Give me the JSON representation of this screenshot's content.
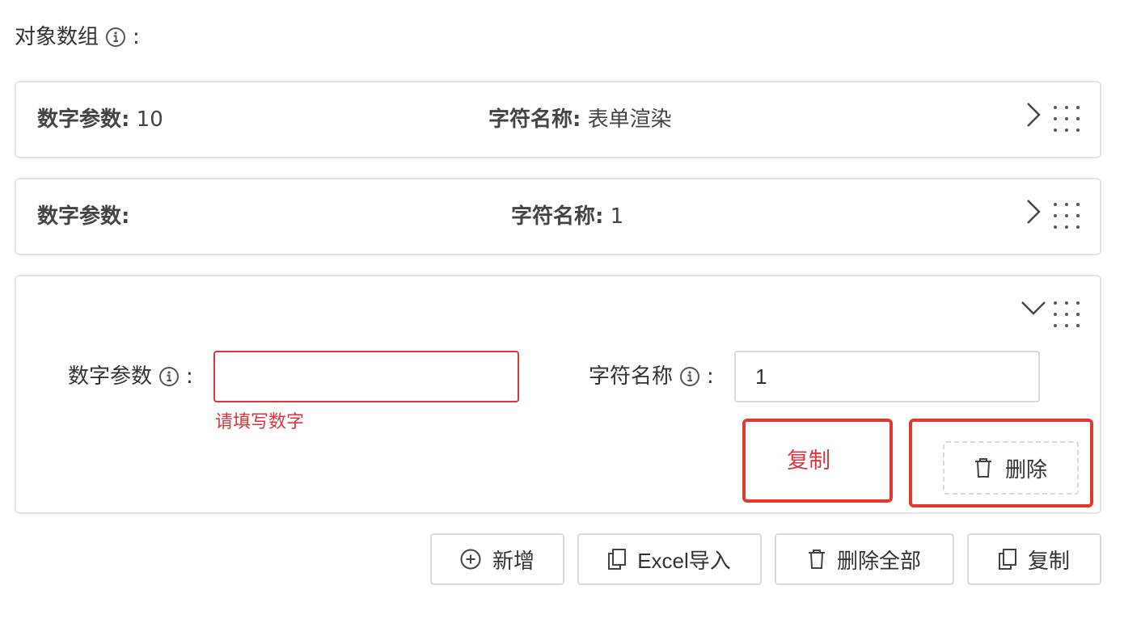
{
  "section": {
    "title": "对象数组",
    "colon": ":"
  },
  "items": [
    {
      "number_label": "数字参数:",
      "number_value": "10",
      "name_label": "字符名称:",
      "name_value": "表单渲染"
    },
    {
      "number_label": "数字参数:",
      "number_value": "",
      "name_label": "字符名称:",
      "name_value": "1"
    }
  ],
  "expanded": {
    "number_label": "数字参数",
    "number_value": "",
    "number_error": "请填写数字",
    "name_label": "字符名称",
    "name_value": "1",
    "colon": ":",
    "copy_label": "复制",
    "delete_label": "删除"
  },
  "toolbar": {
    "add_label": "新增",
    "excel_label": "Excel导入",
    "delete_all_label": "删除全部",
    "copy_label": "复制"
  },
  "colors": {
    "error": "#d9363e",
    "highlight": "#e03a2e",
    "border": "#d9d9d9"
  },
  "icons": [
    "info-icon",
    "chevron-right-icon",
    "chevron-down-icon",
    "drag-handle-icon",
    "trash-icon",
    "plus-circle-icon",
    "copy-icon"
  ]
}
